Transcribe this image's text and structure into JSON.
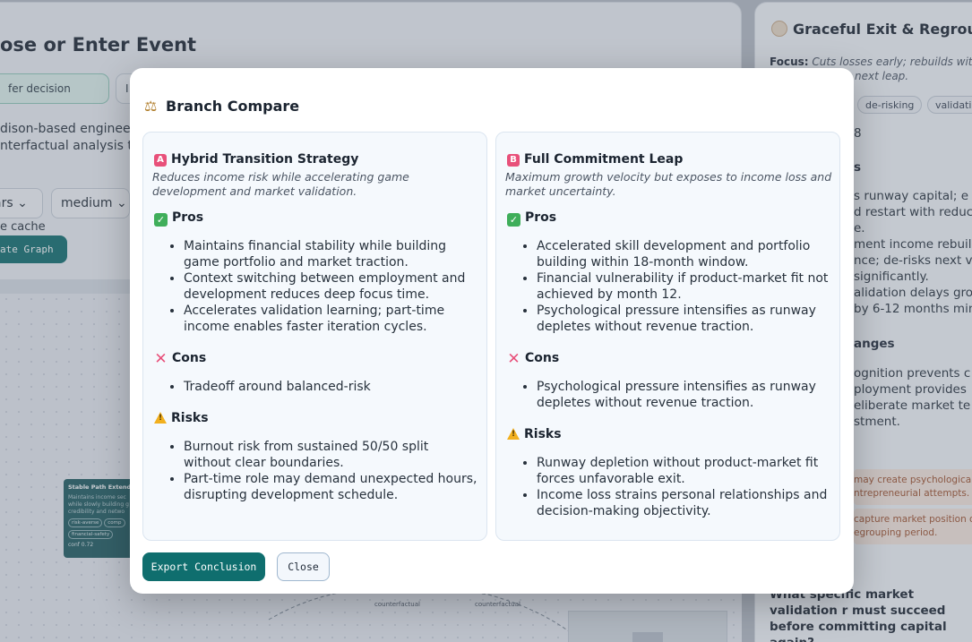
{
  "background": {
    "page_title": "ose or Enter Event",
    "event_input_text": "fer decision",
    "event_input2_text": "I",
    "description_lines": [
      "dison-based enginee",
      "nterfactual analysis te"
    ],
    "select_years": "ars",
    "select_risk": "medium",
    "cache_label": "e cache",
    "generate_button": "ate Graph",
    "node": {
      "title": "Stable Path Extende",
      "desc": "Maintains income sec while slowly building g credibility and netwo",
      "tags": [
        "risk-averse",
        "comp",
        "financial-safety"
      ],
      "conf": "conf 0.72"
    },
    "edge_labels": [
      "counterfactual",
      "counterfactual"
    ]
  },
  "right_panel": {
    "title": "Graceful Exit & Regroup",
    "focus_label": "Focus:",
    "focus_text": "Cuts losses early; rebuilds wit",
    "focus_text2": "next leap.",
    "chips": [
      "de-risking",
      "validatio"
    ],
    "conf_fragment": "8",
    "section_fragment": "s",
    "lines": [
      "s runway capital; e",
      "d restart with reduc",
      "e.",
      "ment income rebuild",
      "nce; de-risks next v",
      "significantly.",
      "alidation delays gro",
      "by 6-12 months min"
    ],
    "changes_heading": "anges",
    "change_lines": [
      "ognition prevents c",
      "ployment provides",
      "eliberate market te",
      "stment."
    ],
    "warnings": [
      [
        "may create psychologica",
        "ntrepreneurial attempts."
      ],
      [
        "capture market position o",
        "egrouping period."
      ]
    ],
    "question": "What specific market validation r must succeed before committing capital again?"
  },
  "modal": {
    "title": "Branch Compare",
    "title_icon": "scale-icon",
    "accent_color": "#0f6e6e",
    "badge_color": "#e8507a",
    "branches": [
      {
        "badge": "A",
        "name": "Hybrid Transition Strategy",
        "summary": "Reduces income risk while accelerating game development and market validation.",
        "pros_label": "Pros",
        "pros": [
          "Maintains financial stability while building game portfolio and market traction.",
          "Context switching between employment and development reduces deep focus time.",
          "Accelerates validation learning; part-time income enables faster iteration cycles."
        ],
        "cons_label": "Cons",
        "cons": [
          "Tradeoff around balanced-risk"
        ],
        "risks_label": "Risks",
        "risks": [
          "Burnout risk from sustained 50/50 split without clear boundaries.",
          "Part-time role may demand unexpected hours, disrupting development schedule."
        ]
      },
      {
        "badge": "B",
        "name": "Full Commitment Leap",
        "summary": "Maximum growth velocity but exposes to income loss and market uncertainty.",
        "pros_label": "Pros",
        "pros": [
          "Accelerated skill development and portfolio building within 18-month window.",
          "Financial vulnerability if product-market fit not achieved by month 12.",
          "Psychological pressure intensifies as runway depletes without revenue traction."
        ],
        "cons_label": "Cons",
        "cons": [
          "Psychological pressure intensifies as runway depletes without revenue traction."
        ],
        "risks_label": "Risks",
        "risks": [
          "Runway depletion without product-market fit forces unfavorable exit.",
          "Income loss strains personal relationships and decision-making objectivity."
        ]
      }
    ],
    "export_button": "Export Conclusion",
    "close_button": "Close"
  }
}
